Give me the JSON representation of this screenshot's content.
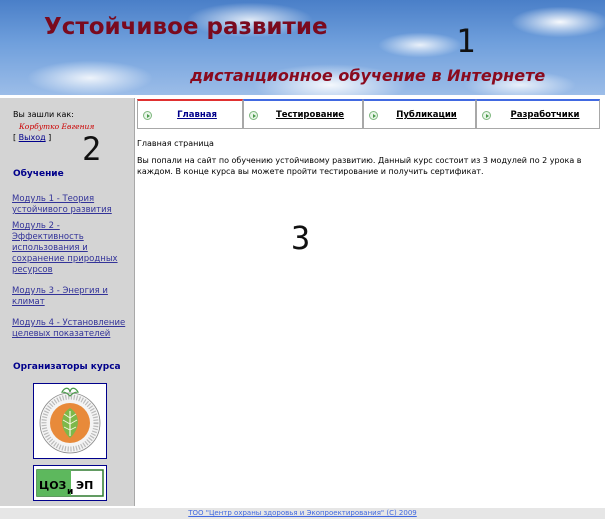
{
  "banner": {
    "title": "Устойчивое развитие",
    "subtitle": "дистанционное обучение в Интернете"
  },
  "region_numbers": {
    "one": "1",
    "two": "2",
    "three": "3"
  },
  "sidebar": {
    "login_label": "Вы зашли как:",
    "user_name": "Корбутко Евгения",
    "logout_open": "[ ",
    "logout_label": "Выход",
    "logout_close": " ]",
    "learning_title": "Обучение",
    "modules": [
      {
        "label": "Модуль 1 - Теория устойчивого развития"
      },
      {
        "label": "Модуль 2 - Эффективность использования и сохранение природных ресурсов"
      },
      {
        "label": "Модуль 3 - Энергия и климат"
      },
      {
        "label": "Модуль 4 - Установление целевых показателей"
      }
    ],
    "organizers_title": "Организаторы курса",
    "ceep_logo_text": {
      "left": "ЦОЗ",
      "mid": "и",
      "right": "ЭП"
    }
  },
  "tabs": [
    {
      "label": "Главная",
      "active": true
    },
    {
      "label": "Тестирование",
      "active": false
    },
    {
      "label": "Публикации",
      "active": false
    },
    {
      "label": "Разработчики",
      "active": false
    }
  ],
  "main": {
    "heading": "Главная страница",
    "intro": "Вы попали на сайт по обучению устойчивому развитию. Данный курс состоит из 3 модулей по 2 урока в каждом. В конце курса вы можете пройти тестирование и получить сертификат."
  },
  "footer": {
    "text": "ТОО \"Центр охраны здоровья и Экопроектирования\" (С) 2009"
  },
  "colors": {
    "title_text": "#7a0a1e",
    "sidebar_bg": "#d4d4d4",
    "link": "#333399",
    "section_title": "#00008b",
    "active_tab_accent": "#e03030",
    "tab_accent": "#4169e1"
  },
  "icons": {
    "tab_icon": "arrow-circle-icon",
    "emblem_logo": "leaf-emblem-logo",
    "ceep_logo": "ceep-logo"
  }
}
